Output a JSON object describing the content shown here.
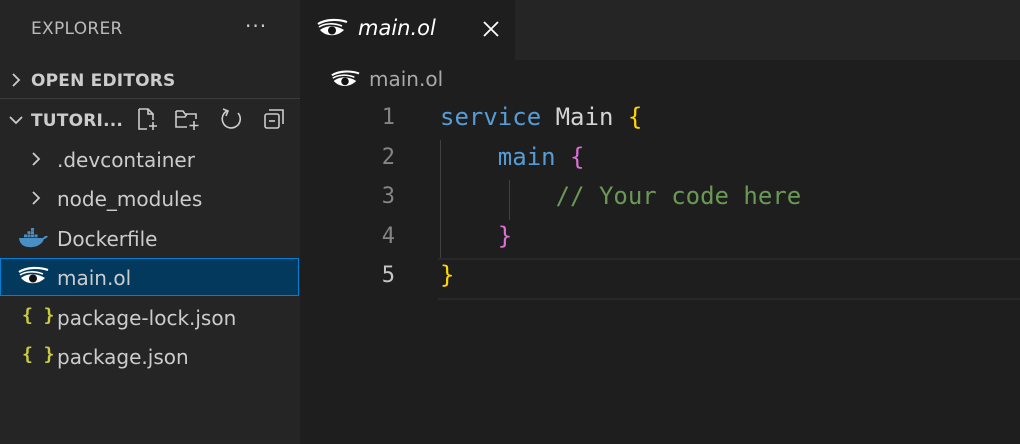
{
  "sidebar": {
    "title": "EXPLORER",
    "more_icon": "ellipsis-icon",
    "sections": {
      "open_editors": "OPEN EDITORS",
      "workspace": "TUTORI..."
    },
    "actions": [
      "new-file-icon",
      "new-folder-icon",
      "refresh-icon",
      "collapse-all-icon"
    ],
    "tree": [
      {
        "label": ".devcontainer",
        "type": "folder"
      },
      {
        "label": "node_modules",
        "type": "folder"
      },
      {
        "label": "Dockerfile",
        "type": "docker"
      },
      {
        "label": "main.ol",
        "type": "jolie",
        "selected": true
      },
      {
        "label": "package-lock.json",
        "type": "json"
      },
      {
        "label": "package.json",
        "type": "json"
      }
    ]
  },
  "tabs": [
    {
      "label": "main.ol",
      "active": true,
      "icon": "jolie-file-icon"
    }
  ],
  "breadcrumb": {
    "file": "main.ol"
  },
  "editor": {
    "line_numbers": [
      "1",
      "2",
      "3",
      "4",
      "5"
    ],
    "active_line": "5",
    "lines": [
      [
        [
          "kw",
          "service"
        ],
        [
          "id",
          " Main "
        ],
        [
          "br1",
          "{"
        ]
      ],
      [
        [
          "id",
          "    "
        ],
        [
          "fn",
          "main"
        ],
        [
          "id",
          " "
        ],
        [
          "br2",
          "{"
        ]
      ],
      [
        [
          "id",
          "        "
        ],
        [
          "cm",
          "// Your code here"
        ]
      ],
      [
        [
          "id",
          "    "
        ],
        [
          "br2",
          "}"
        ]
      ],
      [
        [
          "br1",
          "}"
        ]
      ]
    ]
  },
  "json_icon_glyph": "{ }",
  "colors": {
    "accent_selection": "#04395e",
    "keyword": "#569cd6",
    "comment": "#6a9955",
    "bracket_level1": "#ffd700",
    "bracket_level2": "#da70d6"
  }
}
